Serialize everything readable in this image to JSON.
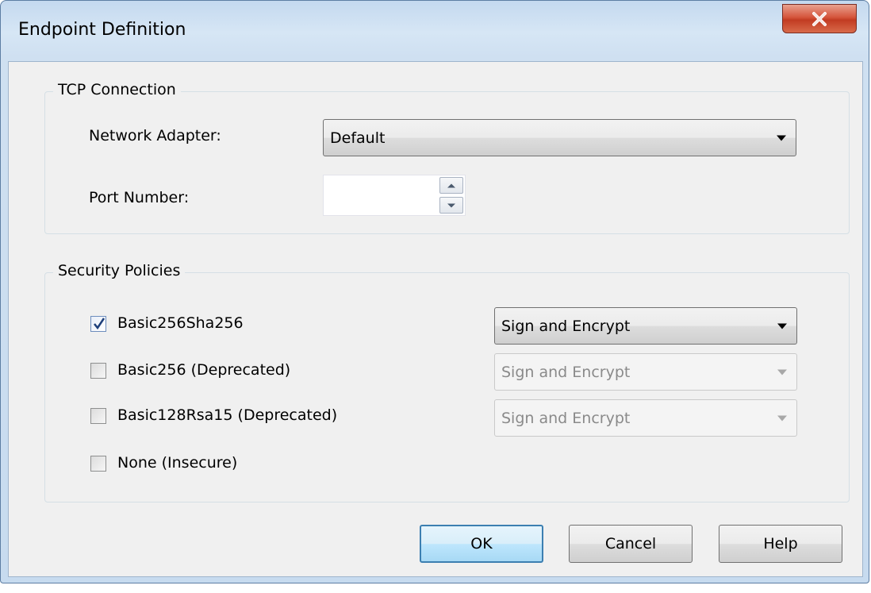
{
  "window": {
    "title": "Endpoint Definition",
    "close_glyph": "X"
  },
  "tcp": {
    "group_label": "TCP Connection",
    "adapter_label": "Network Adapter:",
    "adapter_value": "Default",
    "port_label": "Port Number:",
    "port_value": ""
  },
  "security": {
    "group_label": "Security Policies",
    "policies": [
      {
        "label": "Basic256Sha256",
        "checked": true,
        "mode": "Sign and Encrypt",
        "enabled": true
      },
      {
        "label": "Basic256 (Deprecated)",
        "checked": false,
        "mode": "Sign and Encrypt",
        "enabled": false
      },
      {
        "label": "Basic128Rsa15 (Deprecated)",
        "checked": false,
        "mode": "Sign and Encrypt",
        "enabled": false
      },
      {
        "label": "None (Insecure)",
        "checked": false
      }
    ]
  },
  "buttons": {
    "ok": "OK",
    "cancel": "Cancel",
    "help": "Help"
  },
  "colors": {
    "close_button": "#c8432a",
    "default_button_border": "#3c7fb1",
    "checkmark": "#1e3f7a"
  },
  "icons": {
    "close": "close-icon",
    "dropdown": "chevron-down-icon",
    "checkmark": "checkmark-icon"
  }
}
